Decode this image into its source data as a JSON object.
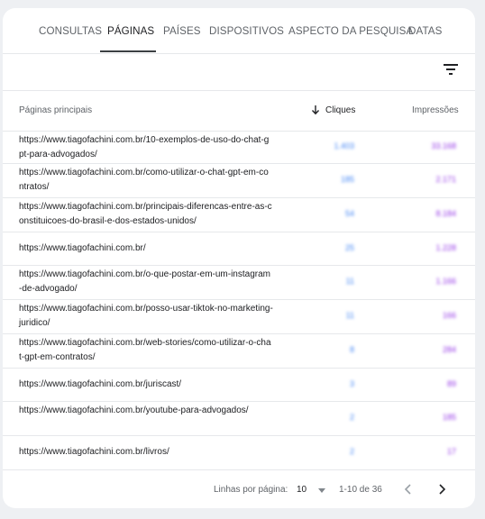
{
  "tabs": [
    {
      "label": "CONSULTAS"
    },
    {
      "label": "PÁGINAS"
    },
    {
      "label": "PAÍSES"
    },
    {
      "label": "DISPOSITIVOS"
    },
    {
      "label": "ASPECTO DA PESQUISA"
    },
    {
      "label": "DATAS"
    }
  ],
  "active_tab": "PÁGINAS",
  "table": {
    "headers": {
      "pages": "Páginas principais",
      "clicks": "Cliques",
      "impressions": "Impressões"
    },
    "sort_icon": "arrow-down-icon",
    "rows": [
      {
        "url": "https://www.tiagofachini.com.br/10-exemplos-de-uso-do-chat-gpt-para-advogados/",
        "clicks": "1.403",
        "impressions": "33.168"
      },
      {
        "url": "https://www.tiagofachini.com.br/como-utilizar-o-chat-gpt-em-contratos/",
        "clicks": "185",
        "impressions": "2.171"
      },
      {
        "url": "https://www.tiagofachini.com.br/principais-diferencas-entre-as-constituicoes-do-brasil-e-dos-estados-unidos/",
        "clicks": "54",
        "impressions": "8.184"
      },
      {
        "url": "https://www.tiagofachini.com.br/",
        "clicks": "25",
        "impressions": "1.228"
      },
      {
        "url": "https://www.tiagofachini.com.br/o-que-postar-em-um-instagram-de-advogado/",
        "clicks": "11",
        "impressions": "1.166"
      },
      {
        "url": "https://www.tiagofachini.com.br/posso-usar-tiktok-no-marketing-juridico/",
        "clicks": "11",
        "impressions": "166"
      },
      {
        "url": "https://www.tiagofachini.com.br/web-stories/como-utilizar-o-chat-gpt-em-contratos/",
        "clicks": "8",
        "impressions": "284"
      },
      {
        "url": "https://www.tiagofachini.com.br/juriscast/",
        "clicks": "3",
        "impressions": "89"
      },
      {
        "url": "https://www.tiagofachini.com.br/youtube-para-advogados/",
        "clicks": "2",
        "impressions": "185"
      },
      {
        "url": "https://www.tiagofachini.com.br/livros/",
        "clicks": "2",
        "impressions": "17"
      }
    ]
  },
  "footer": {
    "rows_per_page_label": "Linhas por página:",
    "rows_per_page_value": "10",
    "range": "1-10 de 36"
  },
  "icons": {
    "filter": "filter-icon",
    "prev": "chevron-left-icon",
    "next": "chevron-right-icon",
    "dropdown": "caret-down-icon"
  },
  "colors": {
    "clicks": "#4285f4",
    "impressions": "#9334e6"
  }
}
